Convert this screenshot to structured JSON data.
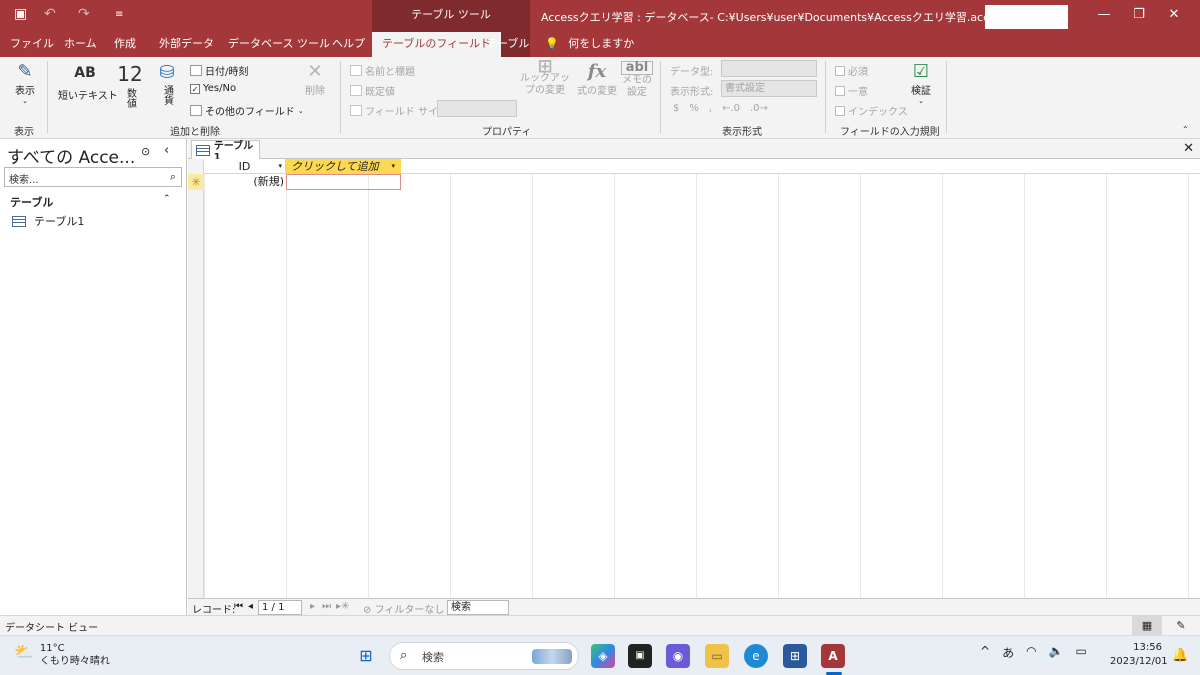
{
  "window": {
    "context_group": "テーブル ツール",
    "title": "Accessクエリ学習 : データベース- C:¥Users¥user¥Documents¥Accessクエリ学習.accd···"
  },
  "menu": {
    "tabs": [
      "ファイル",
      "ホーム",
      "作成",
      "外部データ",
      "データベース ツール",
      "ヘルプ",
      "テーブルのフィールド",
      "テーブル"
    ],
    "tell_me": "何をしますか"
  },
  "ribbon": {
    "view": {
      "label": "表示",
      "group": "表示"
    },
    "add_delete": {
      "group": "追加と削除",
      "short_text": "短いテキスト",
      "short_text_icon": "AB",
      "number_icon": "12",
      "number": "数値",
      "currency": "通貨",
      "date_time": "日付/時刻",
      "yes_no": "Yes/No",
      "more_fields": "その他のフィールド",
      "delete": "削除"
    },
    "properties": {
      "group": "プロパティ",
      "name_caption": "名前と標題",
      "default_value": "既定値",
      "field_size": "フィールド サイズ",
      "lookup": "ルックアップの変更",
      "expression": "式の変更",
      "memo": "メモの設定"
    },
    "formatting": {
      "group": "表示形式",
      "data_type": "データ型:",
      "format": "表示形式:",
      "format_value": "書式設定"
    },
    "validation": {
      "group": "フィールドの入力規則",
      "required": "必須",
      "unique": "一意",
      "indexed": "インデックス",
      "validate": "検証"
    }
  },
  "nav": {
    "title": "すべての Acce...",
    "search_placeholder": "検索...",
    "group": "テーブル",
    "items": [
      "テーブル1"
    ]
  },
  "document": {
    "tab": "テーブル1",
    "columns": [
      "ID",
      "クリックして追加"
    ],
    "new_row_id": "(新規)"
  },
  "record_nav": {
    "label": "レコード:",
    "position": "1 / 1",
    "filter": "フィルターなし",
    "search": "検索"
  },
  "status": {
    "text": "データシート ビュー"
  },
  "taskbar": {
    "temperature": "11°C",
    "weather": "くもり時々晴れ",
    "search_placeholder": "検索",
    "ime": "あ",
    "time": "13:56",
    "date": "2023/12/01"
  },
  "colors": {
    "accent": "#a4373a",
    "context": "#7f2a2d",
    "add_column": "#fcd953"
  }
}
